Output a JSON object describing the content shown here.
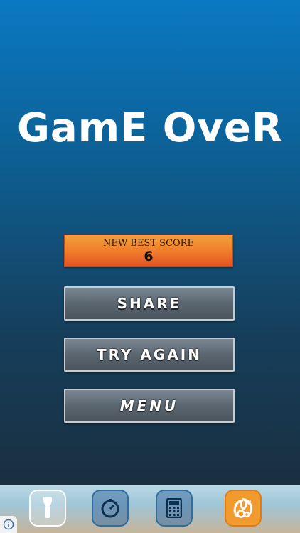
{
  "game_over": {
    "title": "GamE OveR",
    "score_label": "NEW BEST SCORE",
    "score_value": "6"
  },
  "buttons": {
    "share": "SHARE",
    "try_again": "TRY AGAIN",
    "menu": "MENU"
  },
  "dock": {
    "icons": [
      "flashlight-icon",
      "timer-icon",
      "calculator-icon",
      "uc-browser-icon"
    ]
  },
  "colors": {
    "bg_top": "#0a79c3",
    "bg_bottom": "#1b2a37",
    "score_orange": "#ef7a2b",
    "button_gray": "#5b6670"
  }
}
